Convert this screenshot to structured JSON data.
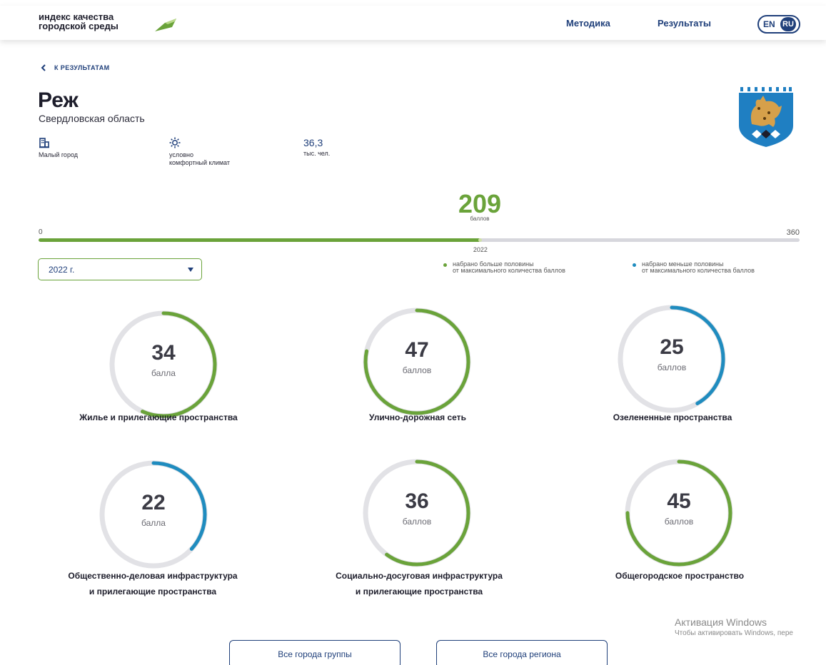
{
  "header": {
    "logo_line1": "индекс качества",
    "logo_line2": "городской среды",
    "nav_method": "Методика",
    "nav_results": "Результаты",
    "lang_en": "EN",
    "lang_ru": "RU"
  },
  "back_label": "К РЕЗУЛЬТАТАМ",
  "city": {
    "name": "Реж",
    "region": "Свердловская область"
  },
  "stats": {
    "type_label": "Малый город",
    "climate_line1": "условно",
    "climate_line2": "комфортный климат",
    "population_value": "36,3",
    "population_unit": "тыс. чел."
  },
  "total": {
    "value": 209,
    "unit": "баллов",
    "min": 0,
    "max": 360,
    "min_label": "0",
    "max_label": "360",
    "year_label": "2022"
  },
  "year_select": {
    "value": "2022 г."
  },
  "legend": {
    "green_line1": "набрано больше половины",
    "green_line2": "от максимального количества баллов",
    "blue_line1": "набрано меньше половины",
    "blue_line2": "от максимального количества баллов"
  },
  "colors": {
    "green": "#6aa33a",
    "blue": "#1f8cbf",
    "navy": "#1f3f7a",
    "track": "#e2e2e6"
  },
  "gauges": [
    {
      "value": "34",
      "unit": "балла",
      "fraction": 0.567,
      "color": "green",
      "title1": "Жилье и прилегающие пространства",
      "title2": ""
    },
    {
      "value": "47",
      "unit": "баллов",
      "fraction": 0.783,
      "color": "green",
      "title1": "Улично-дорожная сеть",
      "title2": ""
    },
    {
      "value": "25",
      "unit": "баллов",
      "fraction": 0.417,
      "color": "blue",
      "title1": "Озелененные пространства",
      "title2": ""
    },
    {
      "value": "22",
      "unit": "балла",
      "fraction": 0.367,
      "color": "blue",
      "title1": "Общественно-деловая инфраструктура",
      "title2": "и прилегающие пространства"
    },
    {
      "value": "36",
      "unit": "баллов",
      "fraction": 0.6,
      "color": "green",
      "title1": "Социально-досуговая инфраструктура",
      "title2": "и прилегающие пространства"
    },
    {
      "value": "45",
      "unit": "баллов",
      "fraction": 0.75,
      "color": "green",
      "title1": "Общегородское пространство",
      "title2": ""
    }
  ],
  "buttons": {
    "group": "Все города группы",
    "region": "Все города региона"
  },
  "watermark": {
    "line1": "Активация Windows",
    "line2": "Чтобы активировать Windows, пере"
  }
}
